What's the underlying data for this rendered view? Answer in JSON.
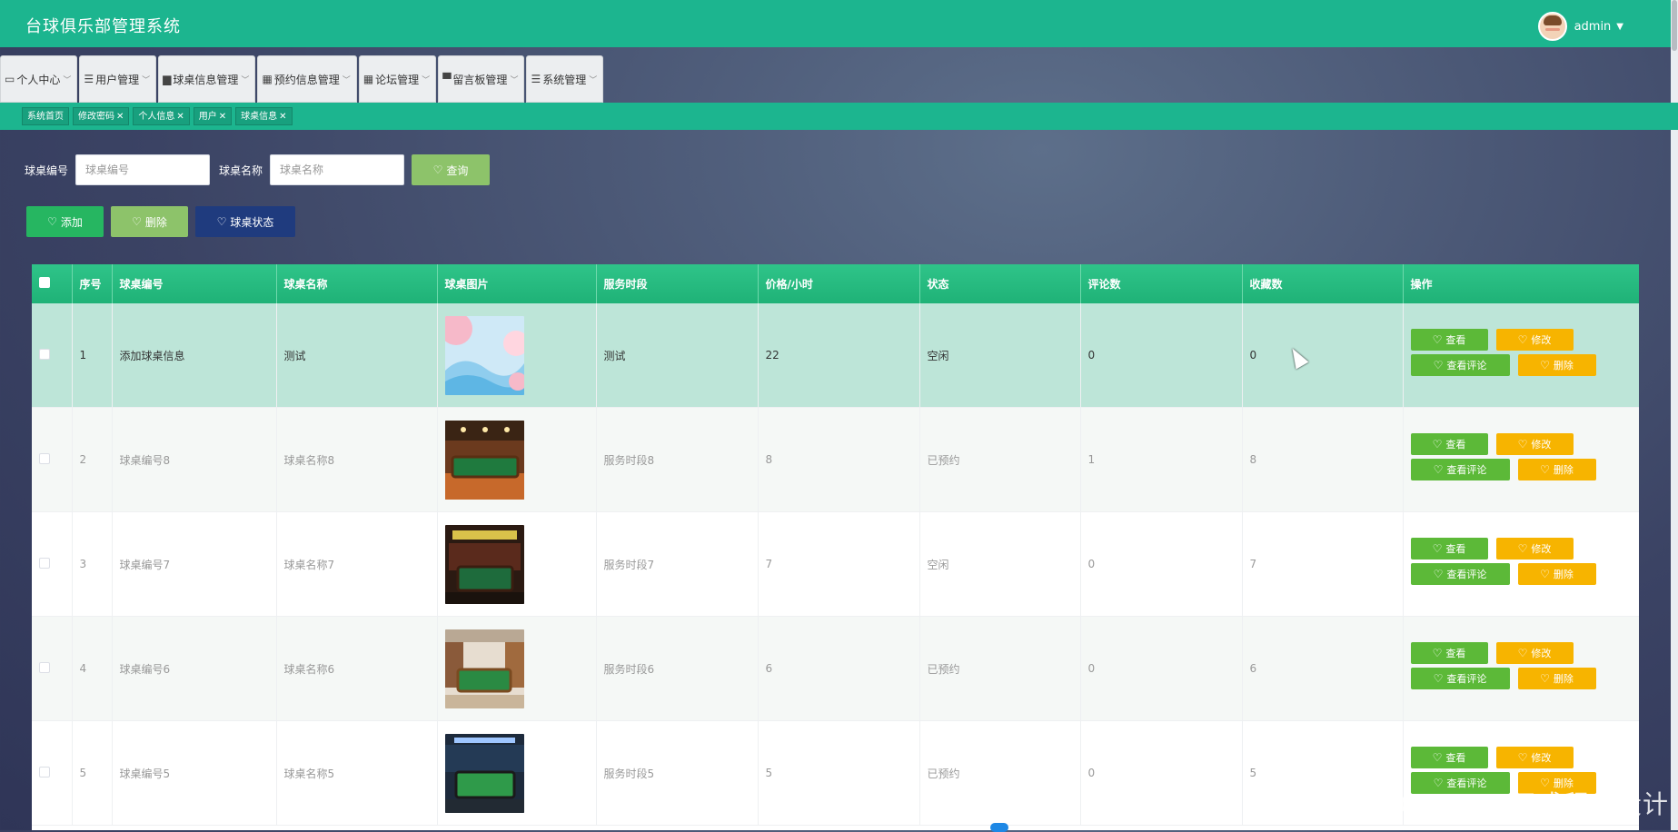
{
  "app": {
    "title": "台球俱乐部管理系统",
    "user": "admin"
  },
  "menu": [
    {
      "label": "个人中心",
      "icon": "calendar-icon"
    },
    {
      "label": "用户管理",
      "icon": "list-icon"
    },
    {
      "label": "球桌信息管理",
      "icon": "printer-icon"
    },
    {
      "label": "预约信息管理",
      "icon": "grid-icon"
    },
    {
      "label": "论坛管理",
      "icon": "grid-icon"
    },
    {
      "label": "留言板管理",
      "icon": "monitor-icon"
    },
    {
      "label": "系统管理",
      "icon": "list-icon"
    }
  ],
  "tags": [
    {
      "label": "系统首页",
      "closable": false
    },
    {
      "label": "修改密码",
      "closable": true
    },
    {
      "label": "个人信息",
      "closable": true
    },
    {
      "label": "用户",
      "closable": true
    },
    {
      "label": "球桌信息",
      "closable": true
    }
  ],
  "search": {
    "no_label": "球桌编号",
    "no_placeholder": "球桌编号",
    "name_label": "球桌名称",
    "name_placeholder": "球桌名称",
    "query_label": "查询"
  },
  "actions": {
    "add": "添加",
    "delete": "删除",
    "status": "球桌状态"
  },
  "table": {
    "headers": [
      "序号",
      "球桌编号",
      "球桌名称",
      "球桌图片",
      "服务时段",
      "价格/小时",
      "状态",
      "评论数",
      "收藏数",
      "操作"
    ],
    "rows": [
      {
        "idx": "1",
        "no": "添加球桌信息",
        "name": "测试",
        "period": "测试",
        "price": "22",
        "status": "空闲",
        "comments": "0",
        "favorites": "0",
        "image": "abstract-pastel"
      },
      {
        "idx": "2",
        "no": "球桌编号8",
        "name": "球桌名称8",
        "period": "服务时段8",
        "price": "8",
        "status": "已预约",
        "comments": "1",
        "favorites": "8",
        "image": "billiard-room-warm"
      },
      {
        "idx": "3",
        "no": "球桌编号7",
        "name": "球桌名称7",
        "period": "服务时段7",
        "price": "7",
        "status": "空闲",
        "comments": "0",
        "favorites": "7",
        "image": "billiard-room-dark"
      },
      {
        "idx": "4",
        "no": "球桌编号6",
        "name": "球桌名称6",
        "period": "服务时段6",
        "price": "6",
        "status": "已预约",
        "comments": "0",
        "favorites": "6",
        "image": "billiard-room-bright"
      },
      {
        "idx": "5",
        "no": "球桌编号5",
        "name": "球桌名称5",
        "period": "服务时段5",
        "price": "5",
        "status": "已预约",
        "comments": "0",
        "favorites": "5",
        "image": "billiard-room-blue"
      }
    ],
    "op_labels": {
      "view": "查看",
      "edit": "修改",
      "comments": "查看评论",
      "delete": "删除"
    }
  },
  "watermark": "CSDN @天成程序设计",
  "colors": {
    "primary": "#1cb58f",
    "view": "#5cb938",
    "edit": "#f7b400",
    "status_btn": "#1f3b7e"
  }
}
